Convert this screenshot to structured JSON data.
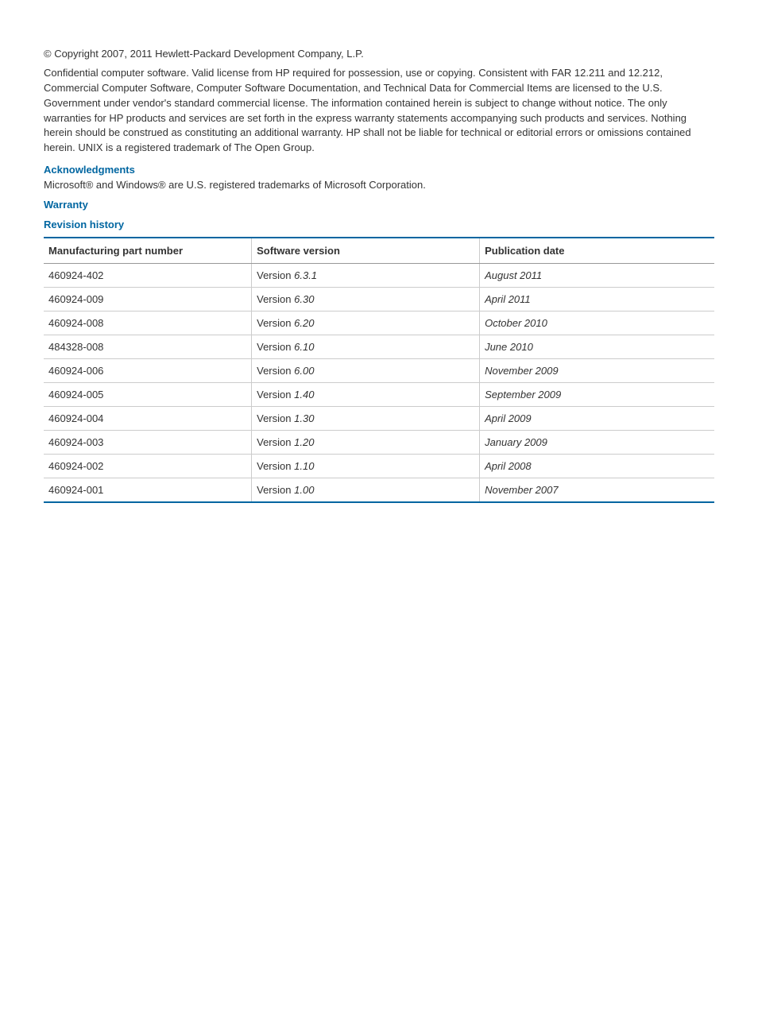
{
  "copyright": "© Copyright 2007, 2011 Hewlett-Packard Development Company, L.P.",
  "legal": "Confidential computer software. Valid license from HP required for possession, use or copying. Consistent with FAR 12.211 and 12.212, Commercial Computer Software, Computer Software Documentation, and Technical Data for Commercial Items are licensed to the U.S. Government under vendor's standard commercial license. The information contained herein is subject to change without notice. The only warranties for HP products and services are set forth in the express warranty statements accompanying such products and services. Nothing herein should be construed as constituting an additional warranty. HP shall not be liable for technical or editorial errors or omissions contained herein. UNIX is a registered trademark of The Open Group.",
  "headings": {
    "acknowledgments": "Acknowledgments",
    "warranty": "Warranty",
    "revision_history": "Revision history"
  },
  "trademark": "Microsoft® and Windows® are U.S. registered trademarks of Microsoft Corporation.",
  "table": {
    "headers": {
      "part_number": "Manufacturing part number",
      "software_version": "Software version",
      "publication_date": "Publication date"
    },
    "version_prefix": "Version",
    "rows": [
      {
        "part_number": "460924-402",
        "version": "6.3.1",
        "date": "August 2011"
      },
      {
        "part_number": "460924-009",
        "version": "6.30",
        "date": "April 2011"
      },
      {
        "part_number": "460924-008",
        "version": "6.20",
        "date": "October 2010"
      },
      {
        "part_number": "484328-008",
        "version": "6.10",
        "date": "June 2010"
      },
      {
        "part_number": "460924-006",
        "version": "6.00",
        "date": "November 2009"
      },
      {
        "part_number": "460924-005",
        "version": "1.40",
        "date": "September 2009"
      },
      {
        "part_number": "460924-004",
        "version": "1.30",
        "date": "April 2009"
      },
      {
        "part_number": "460924-003",
        "version": "1.20",
        "date": "January 2009"
      },
      {
        "part_number": "460924-002",
        "version": "1.10",
        "date": "April 2008"
      },
      {
        "part_number": "460924-001",
        "version": "1.00",
        "date": "November 2007"
      }
    ]
  }
}
